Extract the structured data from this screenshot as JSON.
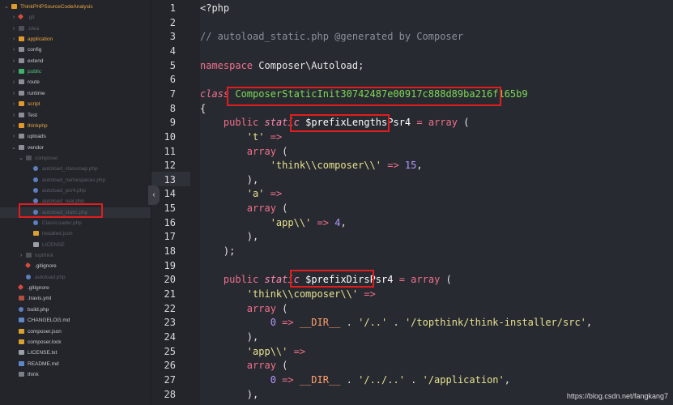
{
  "sidebar": {
    "items": [
      {
        "label": "ThinkPHPSourceCodeAnalysis",
        "kind": "folder-orange",
        "style": "orange-label",
        "chev": "⌄"
      },
      {
        "label": ".git",
        "kind": "file-git",
        "style": "dim",
        "chev": "›"
      },
      {
        "label": ".idea",
        "kind": "folder-dark",
        "style": "dim",
        "chev": "›"
      },
      {
        "label": "application",
        "kind": "folder-orange",
        "style": "orange-label",
        "chev": "›"
      },
      {
        "label": "config",
        "kind": "folder-grey",
        "style": "",
        "chev": "›"
      },
      {
        "label": "extend",
        "kind": "folder-grey",
        "style": "",
        "chev": "›"
      },
      {
        "label": "public",
        "kind": "folder-green",
        "style": "green-label",
        "chev": "›"
      },
      {
        "label": "route",
        "kind": "folder-grey",
        "style": "",
        "chev": "›"
      },
      {
        "label": "runtime",
        "kind": "folder-grey",
        "style": "",
        "chev": "›"
      },
      {
        "label": "script",
        "kind": "folder-orange",
        "style": "orange-label",
        "chev": "›"
      },
      {
        "label": "Test",
        "kind": "folder-grey",
        "style": "",
        "chev": "›"
      },
      {
        "label": "thinkphp",
        "kind": "folder-orange",
        "style": "orange-label",
        "chev": "›"
      },
      {
        "label": "uploads",
        "kind": "folder-grey",
        "style": "",
        "chev": "›"
      },
      {
        "label": "vendor",
        "kind": "folder-grey",
        "style": "",
        "chev": "⌄"
      },
      {
        "label": "composer",
        "kind": "folder-dark",
        "style": "dim",
        "chev": "⌄"
      },
      {
        "label": "autoload_classmap.php",
        "kind": "file-php",
        "style": "dim",
        "chev": ""
      },
      {
        "label": "autoload_namespaces.php",
        "kind": "file-php",
        "style": "dim",
        "chev": ""
      },
      {
        "label": "autoload_psr4.php",
        "kind": "file-php",
        "style": "dim",
        "chev": ""
      },
      {
        "label": "autoload_real.php",
        "kind": "file-php",
        "style": "dim",
        "chev": ""
      },
      {
        "label": "autoload_static.php",
        "kind": "file-php",
        "style": "dim",
        "chev": ""
      },
      {
        "label": "ClassLoader.php",
        "kind": "file-php",
        "style": "dim",
        "chev": ""
      },
      {
        "label": "installed.json",
        "kind": "file-json",
        "style": "dim",
        "chev": ""
      },
      {
        "label": "LICENSE",
        "kind": "file-txt",
        "style": "dim",
        "chev": ""
      },
      {
        "label": "topthink",
        "kind": "folder-dark",
        "style": "dim",
        "chev": "›"
      },
      {
        "label": ".gitignore",
        "kind": "file-git",
        "style": "",
        "chev": ""
      },
      {
        "label": "autoload.php",
        "kind": "file-php",
        "style": "dim",
        "chev": ""
      },
      {
        "label": ".gitignore",
        "kind": "file-git",
        "style": "",
        "chev": ""
      },
      {
        "label": ".travis.yml",
        "kind": "file-yml",
        "style": "",
        "chev": ""
      },
      {
        "label": "build.php",
        "kind": "file-php",
        "style": "",
        "chev": ""
      },
      {
        "label": "CHANGELOG.md",
        "kind": "file-md",
        "style": "",
        "chev": ""
      },
      {
        "label": "composer.json",
        "kind": "file-json",
        "style": "",
        "chev": ""
      },
      {
        "label": "composer.lock",
        "kind": "file-json",
        "style": "",
        "chev": ""
      },
      {
        "label": "LICENSE.txt",
        "kind": "file-txt",
        "style": "",
        "chev": ""
      },
      {
        "label": "README.md",
        "kind": "file-md",
        "style": "",
        "chev": ""
      },
      {
        "label": "think",
        "kind": "file-plain",
        "style": "",
        "chev": ""
      }
    ]
  },
  "editor": {
    "lines": [
      {
        "n": "1",
        "tokens": [
          [
            "<?php",
            "plain"
          ]
        ]
      },
      {
        "n": "2",
        "tokens": []
      },
      {
        "n": "3",
        "tokens": [
          [
            "// autoload_static.php @generated by Composer",
            "comment"
          ]
        ]
      },
      {
        "n": "4",
        "tokens": []
      },
      {
        "n": "5",
        "tokens": [
          [
            "namespace",
            "kw"
          ],
          [
            " Composer\\Autoload;",
            "plain"
          ]
        ]
      },
      {
        "n": "6",
        "tokens": []
      },
      {
        "n": "7",
        "tokens": [
          [
            "class",
            "class"
          ],
          [
            " ",
            "plain"
          ],
          [
            "ComposerStaticInit30742487e00917c888d89ba216f165b9",
            "classname"
          ]
        ]
      },
      {
        "n": "8",
        "tokens": [
          [
            "{",
            "plain"
          ]
        ]
      },
      {
        "n": "9",
        "tokens": [
          [
            "    ",
            "plain"
          ],
          [
            "public",
            "kw"
          ],
          [
            " ",
            "plain"
          ],
          [
            "static",
            "mod"
          ],
          [
            " ",
            "plain"
          ],
          [
            "$prefixLengthsPsr4",
            "var"
          ],
          [
            " ",
            "plain"
          ],
          [
            "=",
            "op"
          ],
          [
            " ",
            "plain"
          ],
          [
            "array",
            "kw"
          ],
          [
            " (",
            "plain"
          ]
        ]
      },
      {
        "n": "10",
        "tokens": [
          [
            "        ",
            "plain"
          ],
          [
            "'t'",
            "str"
          ],
          [
            " ",
            "plain"
          ],
          [
            "=>",
            "op"
          ]
        ]
      },
      {
        "n": "11",
        "tokens": [
          [
            "        ",
            "plain"
          ],
          [
            "array",
            "kw"
          ],
          [
            " (",
            "plain"
          ]
        ]
      },
      {
        "n": "12",
        "tokens": [
          [
            "            ",
            "plain"
          ],
          [
            "'think\\\\composer\\\\'",
            "str"
          ],
          [
            " ",
            "plain"
          ],
          [
            "=>",
            "op"
          ],
          [
            " ",
            "plain"
          ],
          [
            "15",
            "num"
          ],
          [
            ",",
            "plain"
          ]
        ]
      },
      {
        "n": "13",
        "tokens": [
          [
            "        ),",
            "plain"
          ]
        ]
      },
      {
        "n": "14",
        "tokens": [
          [
            "        ",
            "plain"
          ],
          [
            "'a'",
            "str"
          ],
          [
            " ",
            "plain"
          ],
          [
            "=>",
            "op"
          ]
        ]
      },
      {
        "n": "15",
        "tokens": [
          [
            "        ",
            "plain"
          ],
          [
            "array",
            "kw"
          ],
          [
            " (",
            "plain"
          ]
        ]
      },
      {
        "n": "16",
        "tokens": [
          [
            "            ",
            "plain"
          ],
          [
            "'app\\\\'",
            "str"
          ],
          [
            " ",
            "plain"
          ],
          [
            "=>",
            "op"
          ],
          [
            " ",
            "plain"
          ],
          [
            "4",
            "num"
          ],
          [
            ",",
            "plain"
          ]
        ]
      },
      {
        "n": "17",
        "tokens": [
          [
            "        ),",
            "plain"
          ]
        ]
      },
      {
        "n": "18",
        "tokens": [
          [
            "    );",
            "plain"
          ]
        ]
      },
      {
        "n": "19",
        "tokens": []
      },
      {
        "n": "20",
        "tokens": [
          [
            "    ",
            "plain"
          ],
          [
            "public",
            "kw"
          ],
          [
            " ",
            "plain"
          ],
          [
            "static",
            "mod"
          ],
          [
            " ",
            "plain"
          ],
          [
            "$prefixDirsPsr4",
            "var"
          ],
          [
            " ",
            "plain"
          ],
          [
            "=",
            "op"
          ],
          [
            " ",
            "plain"
          ],
          [
            "array",
            "kw"
          ],
          [
            " (",
            "plain"
          ]
        ]
      },
      {
        "n": "21",
        "tokens": [
          [
            "        ",
            "plain"
          ],
          [
            "'think\\\\composer\\\\'",
            "str"
          ],
          [
            " ",
            "plain"
          ],
          [
            "=>",
            "op"
          ]
        ]
      },
      {
        "n": "22",
        "tokens": [
          [
            "        ",
            "plain"
          ],
          [
            "array",
            "kw"
          ],
          [
            " (",
            "plain"
          ]
        ]
      },
      {
        "n": "23",
        "tokens": [
          [
            "            ",
            "plain"
          ],
          [
            "0",
            "num"
          ],
          [
            " ",
            "plain"
          ],
          [
            "=>",
            "op"
          ],
          [
            " ",
            "plain"
          ],
          [
            "__DIR__",
            "const"
          ],
          [
            " . ",
            "plain"
          ],
          [
            "'/..'",
            "str"
          ],
          [
            " . ",
            "plain"
          ],
          [
            "'/topthink/think-installer/src'",
            "str"
          ],
          [
            ",",
            "plain"
          ]
        ]
      },
      {
        "n": "24",
        "tokens": [
          [
            "        ),",
            "plain"
          ]
        ]
      },
      {
        "n": "25",
        "tokens": [
          [
            "        ",
            "plain"
          ],
          [
            "'app\\\\'",
            "str"
          ],
          [
            " ",
            "plain"
          ],
          [
            "=>",
            "op"
          ]
        ]
      },
      {
        "n": "26",
        "tokens": [
          [
            "        ",
            "plain"
          ],
          [
            "array",
            "kw"
          ],
          [
            " (",
            "plain"
          ]
        ]
      },
      {
        "n": "27",
        "tokens": [
          [
            "            ",
            "plain"
          ],
          [
            "0",
            "num"
          ],
          [
            " ",
            "plain"
          ],
          [
            "=>",
            "op"
          ],
          [
            " ",
            "plain"
          ],
          [
            "__DIR__",
            "const"
          ],
          [
            " . ",
            "plain"
          ],
          [
            "'/../..'",
            "str"
          ],
          [
            " . ",
            "plain"
          ],
          [
            "'/application'",
            "str"
          ],
          [
            ",",
            "plain"
          ]
        ]
      },
      {
        "n": "28",
        "tokens": [
          [
            "        ),",
            "plain"
          ]
        ]
      }
    ]
  },
  "collapse_glyph": "‹",
  "watermark": "https://blog.csdn.net/fangkang7"
}
